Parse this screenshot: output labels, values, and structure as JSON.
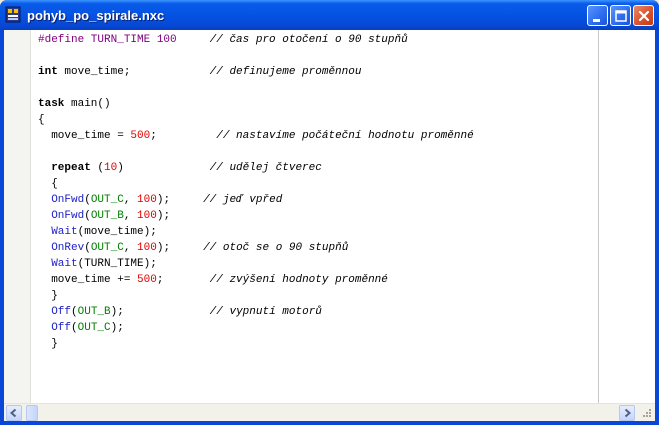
{
  "window": {
    "title": "pohyb_po_spirale.nxc",
    "buttons": {
      "minimize": "minimize-button",
      "maximize": "maximize-button",
      "close": "close-button"
    }
  },
  "editor": {
    "lines": [
      [
        [
          "kw-pre",
          "#define TURN_TIME 100"
        ],
        [
          "plain",
          "     "
        ],
        [
          "cm",
          "// čas pro otočení o 90 stupňů"
        ]
      ],
      [],
      [
        [
          "kw",
          "int"
        ],
        [
          "plain",
          " move_time;            "
        ],
        [
          "cm",
          "// definujeme proměnnou"
        ]
      ],
      [],
      [
        [
          "kw",
          "task"
        ],
        [
          "plain",
          " main()"
        ]
      ],
      [
        [
          "plain",
          "{"
        ]
      ],
      [
        [
          "plain",
          "  move_time = "
        ],
        [
          "num",
          "500"
        ],
        [
          "plain",
          ";         "
        ],
        [
          "cm",
          "// nastavíme počáteční hodnotu proměnné"
        ]
      ],
      [],
      [
        [
          "plain",
          "  "
        ],
        [
          "kw",
          "repeat"
        ],
        [
          "plain",
          " ("
        ],
        [
          "num",
          "10"
        ],
        [
          "plain",
          ")             "
        ],
        [
          "cm",
          "// udělej čtverec"
        ]
      ],
      [
        [
          "plain",
          "  {"
        ]
      ],
      [
        [
          "plain",
          "  "
        ],
        [
          "func",
          "OnFwd"
        ],
        [
          "plain",
          "("
        ],
        [
          "const",
          "OUT_C"
        ],
        [
          "plain",
          ", "
        ],
        [
          "num",
          "100"
        ],
        [
          "plain",
          ");     "
        ],
        [
          "cm",
          "// jeď vpřed"
        ]
      ],
      [
        [
          "plain",
          "  "
        ],
        [
          "func",
          "OnFwd"
        ],
        [
          "plain",
          "("
        ],
        [
          "const",
          "OUT_B"
        ],
        [
          "plain",
          ", "
        ],
        [
          "num",
          "100"
        ],
        [
          "plain",
          ");"
        ]
      ],
      [
        [
          "plain",
          "  "
        ],
        [
          "func",
          "Wait"
        ],
        [
          "plain",
          "(move_time);"
        ]
      ],
      [
        [
          "plain",
          "  "
        ],
        [
          "func",
          "OnRev"
        ],
        [
          "plain",
          "("
        ],
        [
          "const",
          "OUT_C"
        ],
        [
          "plain",
          ", "
        ],
        [
          "num",
          "100"
        ],
        [
          "plain",
          ");     "
        ],
        [
          "cm",
          "// otoč se o 90 stupňů"
        ]
      ],
      [
        [
          "plain",
          "  "
        ],
        [
          "func",
          "Wait"
        ],
        [
          "plain",
          "(TURN_TIME);"
        ]
      ],
      [
        [
          "plain",
          "  move_time += "
        ],
        [
          "num",
          "500"
        ],
        [
          "plain",
          ";       "
        ],
        [
          "cm",
          "// zvýšení hodnoty proměnné"
        ]
      ],
      [
        [
          "plain",
          "  }"
        ]
      ],
      [
        [
          "plain",
          "  "
        ],
        [
          "func",
          "Off"
        ],
        [
          "plain",
          "("
        ],
        [
          "const",
          "OUT_B"
        ],
        [
          "plain",
          ");             "
        ],
        [
          "cm",
          "// vypnutí motorů"
        ]
      ],
      [
        [
          "plain",
          "  "
        ],
        [
          "func",
          "Off"
        ],
        [
          "plain",
          "("
        ],
        [
          "const",
          "OUT_C"
        ],
        [
          "plain",
          ");"
        ]
      ],
      [
        [
          "plain",
          "  }"
        ]
      ]
    ]
  },
  "colors": {
    "preprocessor": "#800080",
    "number": "#E00000",
    "function": "#2020C8",
    "constant": "#008000",
    "titlebar": "#0553E3"
  },
  "icons": {
    "app": "nxc-file-icon",
    "scroll_left": "arrow-left-icon",
    "scroll_right": "arrow-right-icon",
    "resize": "resize-grip-icon"
  }
}
